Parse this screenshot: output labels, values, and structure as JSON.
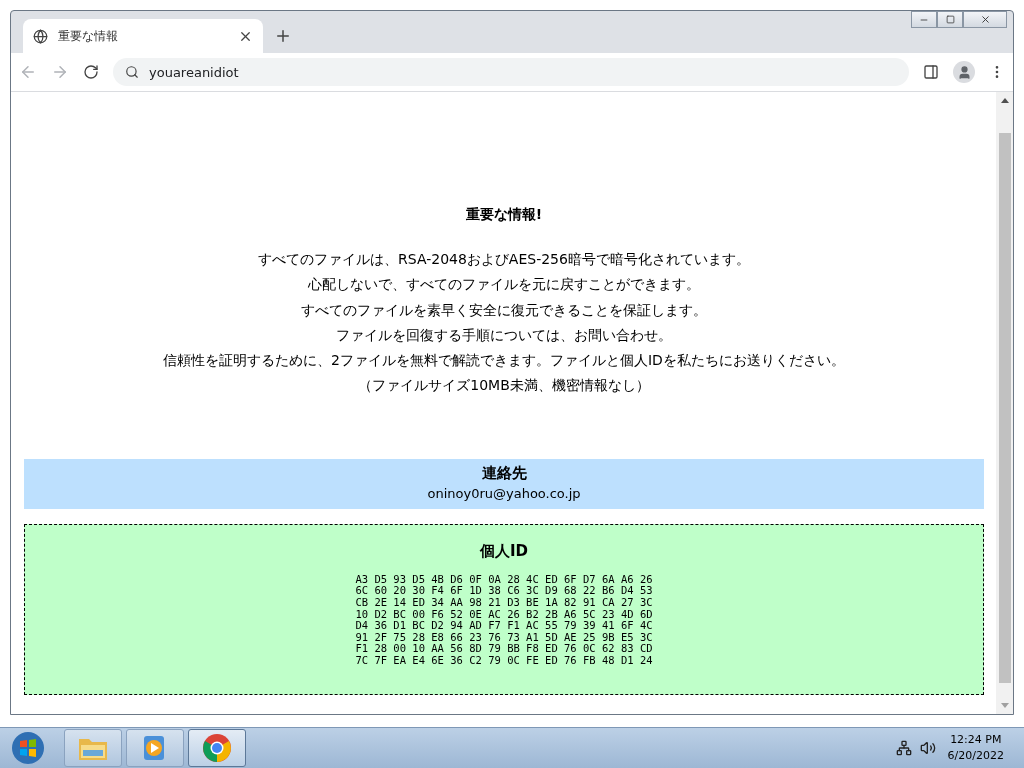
{
  "tab": {
    "title": "重要な情報",
    "selected": true
  },
  "address_bar": {
    "value": "youareanidiot"
  },
  "page": {
    "heading": "重要な情報!",
    "paragraph_lines": [
      "すべてのファイルは、RSA-2048およびAES-256暗号で暗号化されています。",
      "心配しないで、すべてのファイルを元に戻すことができます。",
      "すべてのファイルを素早く安全に復元できることを保証します。",
      "ファイルを回復する手順については、お問い合わせ。",
      "信頼性を証明するために、2ファイルを無料で解読できます。ファイルと個人IDを私たちにお送りください。",
      "（ファイルサイズ10MB未満、機密情報なし）"
    ],
    "contact": {
      "title": "連絡先",
      "email": "oninoy0ru@yahoo.co.jp"
    },
    "personal_id": {
      "title": "個人ID",
      "lines": [
        "A3 D5 93 D5 4B D6 0F 0A 28 4C ED 6F D7 6A A6 26",
        "6C 60 20 30 F4 6F 1D 38 C6 3C D9 68 22 B6 D4 53",
        "CB 2E 14 ED 34 AA 98 21 D3 BE 1A 82 91 CA 27 3C",
        "10 D2 BC 00 F6 52 0E AC 26 B2 2B A6 5C 23 4D 6D",
        "D4 36 D1 BC D2 94 AD F7 F1 AC 55 79 39 41 6F 4C",
        "91 2F 75 28 E8 66 23 76 73 A1 5D AE 25 9B E5 3C",
        "F1 28 00 10 AA 56 8D 79 BB F8 ED 76 0C 62 83 CD",
        "7C 7F EA E4 6E 36 C2 79 0C FE ED 76 FB 48 D1 24"
      ]
    }
  },
  "taskbar": {
    "items": [
      {
        "kind": "explorer",
        "selected": false
      },
      {
        "kind": "media",
        "selected": false
      },
      {
        "kind": "chrome",
        "selected": true
      }
    ],
    "time": "12:24 PM",
    "date": "6/20/2022"
  }
}
